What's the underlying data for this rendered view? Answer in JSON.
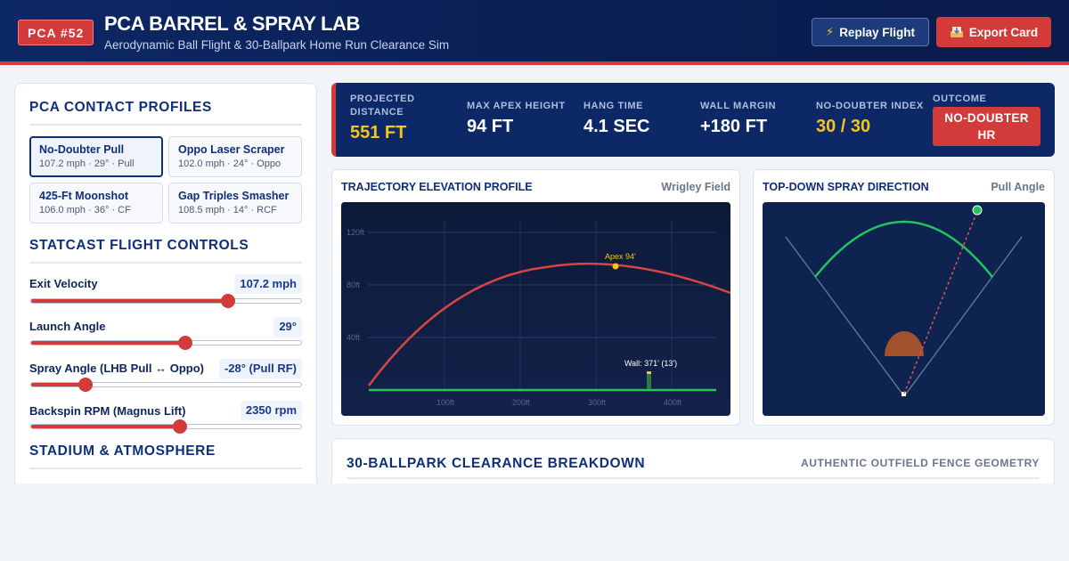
{
  "header": {
    "badge": "PCA #52",
    "title": "PCA BARREL & SPRAY LAB",
    "subtitle": "Aerodynamic Ball Flight & 30-Ballpark Home Run Clearance Sim",
    "replay_label": "Replay Flight",
    "export_label": "Export Card",
    "accent": "#d33a3a",
    "bg": "#0d2866"
  },
  "profiles_section": {
    "title": "PCA CONTACT PROFILES",
    "items": [
      {
        "name": "No-Doubter Pull",
        "sub": "107.2 mph · 29° · Pull",
        "active": true
      },
      {
        "name": "Oppo Laser Scraper",
        "sub": "102.0 mph · 24° · Oppo",
        "active": false
      },
      {
        "name": "425-Ft Moonshot",
        "sub": "106.0 mph · 36° · CF",
        "active": false
      },
      {
        "name": "Gap Triples Smasher",
        "sub": "108.5 mph · 14° · RCF",
        "active": false
      }
    ]
  },
  "controls_section": {
    "title": "STATCAST FLIGHT CONTROLS",
    "sliders": [
      {
        "label": "Exit Velocity",
        "value": "107.2 mph",
        "fraction": 0.73
      },
      {
        "label": "Launch Angle",
        "value": "29°",
        "fraction": 0.57
      },
      {
        "label": "Spray Angle (LHB Pull ↔ Oppo)",
        "value": "-28° (Pull RF)",
        "fraction": 0.2
      },
      {
        "label": "Backspin RPM (Magnus Lift)",
        "value": "2350 rpm",
        "fraction": 0.55
      }
    ]
  },
  "stadium_section": {
    "title": "STADIUM & ATMOSPHERE"
  },
  "stats": [
    {
      "label": "PROJECTED DISTANCE",
      "value": "551 FT",
      "highlight": true
    },
    {
      "label": "MAX APEX HEIGHT",
      "value": "94 FT",
      "highlight": false
    },
    {
      "label": "HANG TIME",
      "value": "4.1 SEC",
      "highlight": false
    },
    {
      "label": "WALL MARGIN",
      "value": "+180 FT",
      "highlight": false
    },
    {
      "label": "NO-DOUBTER INDEX",
      "value": "30 / 30",
      "highlight": true
    }
  ],
  "outcome": {
    "label": "OUTCOME",
    "line1": "NO-DOUBTER",
    "line2": "HR"
  },
  "trajectory_card": {
    "title": "TRAJECTORY ELEVATION PROFILE",
    "meta": "Wrigley Field",
    "y_ticks": [
      "120ft",
      "80ft",
      "40ft"
    ],
    "x_ticks": [
      "100ft",
      "200ft",
      "300ft",
      "400ft"
    ],
    "apex_label": "Apex 94'",
    "wall_label": "Wall: 371' (13')",
    "trajectory_color": "#d94444",
    "ground_color": "#22c55e"
  },
  "spray_card": {
    "title": "TOP-DOWN SPRAY DIRECTION",
    "meta": "Pull Angle",
    "arc_color": "#22c55e",
    "infield_color": "#a0522d"
  },
  "clearance_section": {
    "title": "30-BALLPARK CLEARANCE BREAKDOWN",
    "meta": "AUTHENTIC OUTFIELD FENCE GEOMETRY"
  }
}
